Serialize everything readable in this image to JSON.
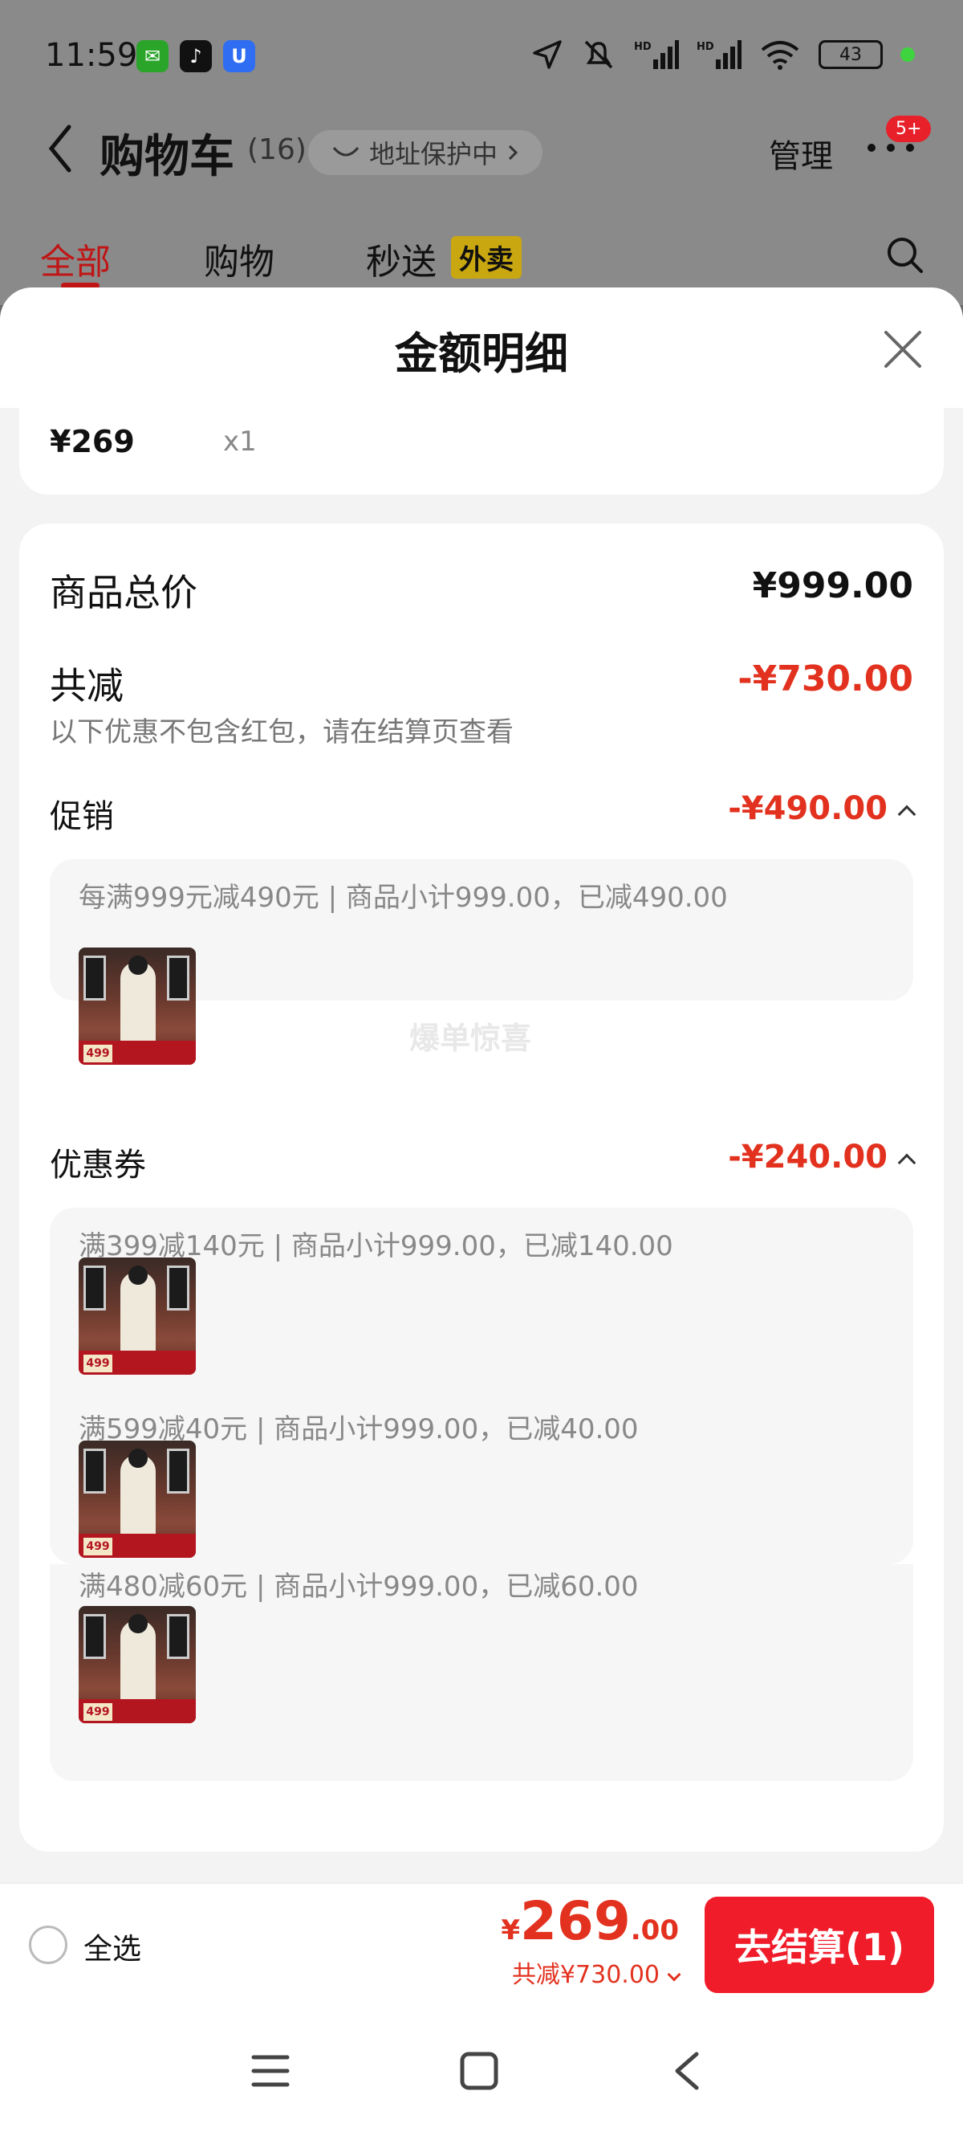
{
  "status_bar": {
    "time": "11:59",
    "apps": [
      {
        "name": "wechat-icon",
        "glyph": "✉"
      },
      {
        "name": "tiktok-icon",
        "glyph": "♪"
      },
      {
        "name": "u-app-icon",
        "glyph": "U"
      }
    ],
    "battery": "43"
  },
  "nav": {
    "title": "购物车",
    "count": "(16)",
    "address_pill": "地址保护中",
    "manage": "管理",
    "badge": "5+"
  },
  "tabs": {
    "all": "全部",
    "shopping": "购物",
    "fast": "秒送",
    "waimai": "外卖"
  },
  "sheet": {
    "title": "金额明细",
    "item_price": "¥269",
    "item_qty": "x1",
    "total_label": "商品总价",
    "total_value": "¥999.00",
    "reduce_label": "共减",
    "reduce_value": "-¥730.00",
    "reduce_note": "以下优惠不包含红包，请在结算页查看",
    "promo": {
      "label": "促销",
      "value": "-¥490.00",
      "rule": "每满999元减490元 | 商品小计999.00，已减490.00",
      "watermark": "爆单惊喜",
      "thumb_price": "499"
    },
    "coupon": {
      "label": "优惠券",
      "value": "-¥240.00",
      "rules": [
        "满399减140元 | 商品小计999.00，已减140.00",
        "满599减40元 | 商品小计999.00，已减40.00",
        "满480减60元 | 商品小计999.00，已减60.00"
      ],
      "thumb_price": "499"
    }
  },
  "checkout": {
    "select_all": "全选",
    "currency": "¥",
    "total_int": "269",
    "total_dec": ".00",
    "saved": "共减¥730.00",
    "button": "去结算(1)"
  },
  "colors": {
    "accent_red": "#e2321f",
    "button_red": "#f01c2a",
    "tab_active": "#c01515"
  }
}
